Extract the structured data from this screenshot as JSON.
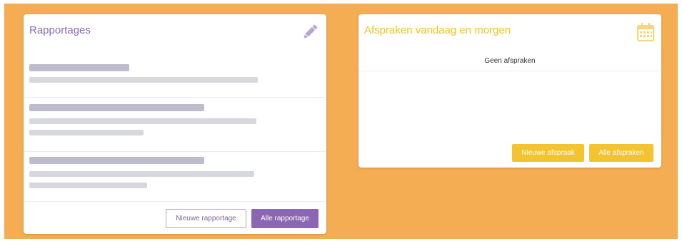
{
  "reports": {
    "title": "Rapportages",
    "edit_icon": "pencil-icon",
    "buttons": {
      "new": "Nieuwe rapportage",
      "all": "Alle rapportage"
    }
  },
  "appointments": {
    "title": "Afspraken vandaag en morgen",
    "calendar_icon": "calendar-icon",
    "empty_text": "Geen afspraken",
    "buttons": {
      "new": "Nieuwe afspraak",
      "all": "Alle afspraken"
    }
  },
  "colors": {
    "background": "#f4ad52",
    "reports_accent": "#8b67b3",
    "appointments_accent": "#f4c430"
  }
}
